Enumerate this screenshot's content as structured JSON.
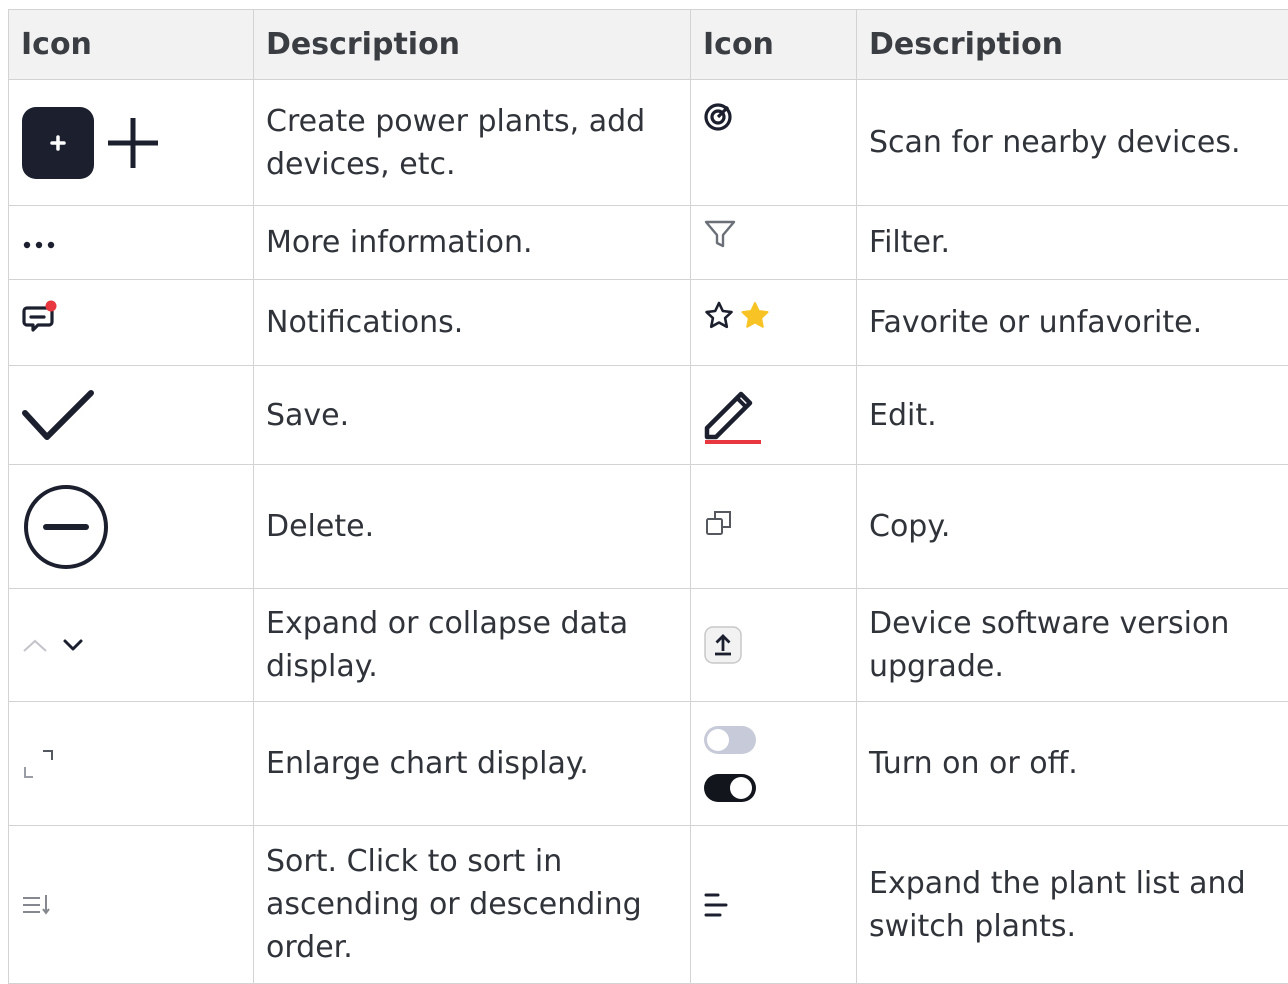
{
  "headers": [
    "Icon",
    "Description",
    "Icon",
    "Description"
  ],
  "rows": [
    {
      "icon1": "add-icon",
      "desc1": "Create power plants, add devices, etc.",
      "icon2": "scan-icon",
      "desc2": "Scan for nearby devices."
    },
    {
      "icon1": "more-icon",
      "desc1": "More information.",
      "icon2": "filter-icon",
      "desc2": "Filter."
    },
    {
      "icon1": "notification-icon",
      "desc1": "Notifications.",
      "icon2": "favorite-icon",
      "desc2": "Favorite or unfavorite."
    },
    {
      "icon1": "checkmark-icon",
      "desc1": "Save.",
      "icon2": "edit-icon",
      "desc2": "Edit."
    },
    {
      "icon1": "delete-icon",
      "desc1": "Delete.",
      "icon2": "copy-icon",
      "desc2": "Copy."
    },
    {
      "icon1": "expand-collapse-icon",
      "desc1": "Expand or collapse data display.",
      "icon2": "upgrade-icon",
      "desc2": "Device software version upgrade."
    },
    {
      "icon1": "enlarge-icon",
      "desc1": "Enlarge chart display.",
      "icon2": "toggle-icon",
      "desc2": "Turn on or off."
    },
    {
      "icon1": "sort-icon",
      "desc1": "Sort. Click to sort in ascending or descending order.",
      "icon2": "plant-list-icon",
      "desc2": "Expand the plant list and switch plants."
    }
  ],
  "colors": {
    "header_bg": "#f2f2f2",
    "border": "#d3d3d3",
    "icon_dark": "#1b1f2e",
    "notification_dot": "#e8373f",
    "edit_underline": "#e8373f",
    "star_fill": "#f7c325"
  }
}
